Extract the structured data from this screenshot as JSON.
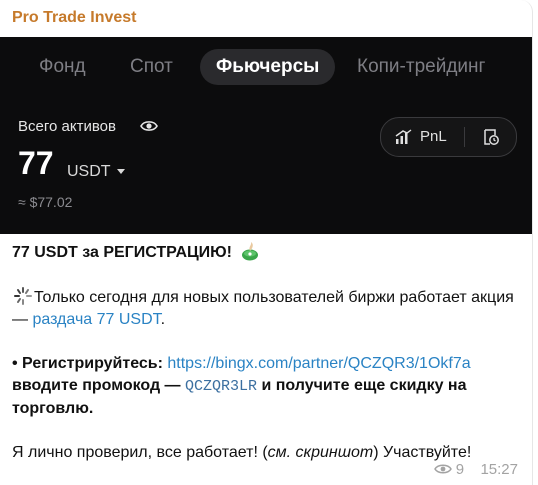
{
  "channel_name": "Pro Trade Invest",
  "screenshot": {
    "tabs": [
      "Фонд",
      "Спот",
      "Фьючерсы",
      "Копи-трейдинг"
    ],
    "active_tab": "Фьючерсы",
    "assets_label": "Всего активов",
    "value": "77",
    "currency": "USDT",
    "usd_value": "≈ $77.02",
    "pnl_label": "PnL"
  },
  "message": {
    "headline": "77 USDT за РЕГИСТРАЦИЮ!",
    "line1_text": "Только сегодня для новых пользователей биржи работает акция — ",
    "line1_link": "раздача 77 USDT",
    "line1_end": ".",
    "line2_bullet": "• Регистрируйтесь: ",
    "line2_link": "https://bingx.com/partner/QCZQR3/1Okf7a",
    "line3_prefix": "вводите промокод — ",
    "promo_code": "QCZQR3LR",
    "line3_suffix": " и получите еще скидку на торговлю.",
    "line4_text": "Я лично проверил, все работает! (",
    "line4_italic": "см. скриншот",
    "line4_end": ") Участвуйте!"
  },
  "meta": {
    "views": "9",
    "time": "15:27"
  },
  "colors": {
    "sender": "#c67a2b",
    "link": "#2a83c4",
    "screenshot_bg": "#0c0c0d"
  }
}
